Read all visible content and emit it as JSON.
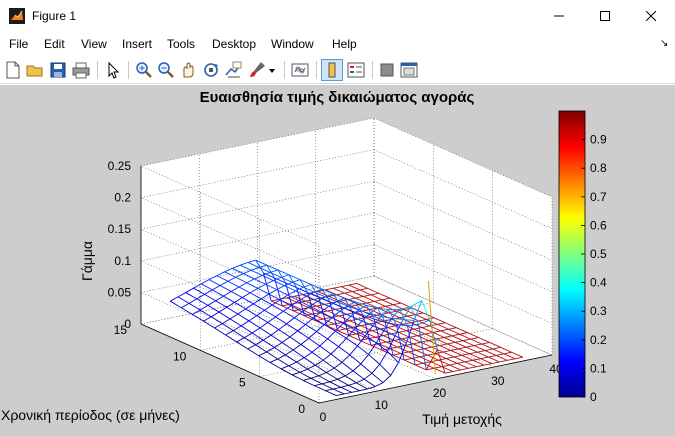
{
  "window": {
    "title": "Figure 1"
  },
  "menu": [
    "File",
    "Edit",
    "View",
    "Insert",
    "Tools",
    "Desktop",
    "Window",
    "Help"
  ],
  "toolbar": {
    "icons": [
      "new-figure-icon",
      "open-file-icon",
      "save-icon",
      "print-icon",
      "edit-plot-arrow-icon",
      "zoom-in-icon",
      "zoom-out-icon",
      "pan-icon",
      "rotate-3d-icon",
      "data-cursor-icon",
      "brush-icon",
      "link-plot-icon",
      "colorbar-icon",
      "legend-icon",
      "hide-plot-tools-icon",
      "show-plot-tools-icon"
    ]
  },
  "chart_data": {
    "type": "surface",
    "title": "Ευαισθησία τιμής δικαιώματος αγοράς",
    "xlabel": "Τιμή μετοχής",
    "ylabel": "Χρονική περίοδος (σε μήνες)",
    "zlabel": "Γάμμα",
    "xlim": [
      0,
      40
    ],
    "ylim": [
      0,
      15
    ],
    "zlim": [
      0,
      0.25
    ],
    "xticks": [
      "0",
      "10",
      "20",
      "30",
      "40"
    ],
    "yticks": [
      "0",
      "5",
      "10",
      "15"
    ],
    "zticks": [
      "0",
      "0.05",
      "0.1",
      "0.15",
      "0.2",
      "0.25"
    ],
    "colorbar": {
      "ticks": [
        "0",
        "0.1",
        "0.2",
        "0.3",
        "0.4",
        "0.5",
        "0.6",
        "0.7",
        "0.8",
        "0.9"
      ],
      "range": [
        0,
        1
      ],
      "colormap": "jet"
    },
    "surface_model": {
      "description_of_shape": "",
      "grid_x_count": 25,
      "grid_y_count": 16,
      "peak_price": 20,
      "peak_z_short_maturity": 0.15,
      "plateau_z_long_maturity": 0.07
    },
    "grid": true
  },
  "colors": {
    "figure_bg": "#cdcdcd",
    "axes_bg": "#ffffff"
  }
}
